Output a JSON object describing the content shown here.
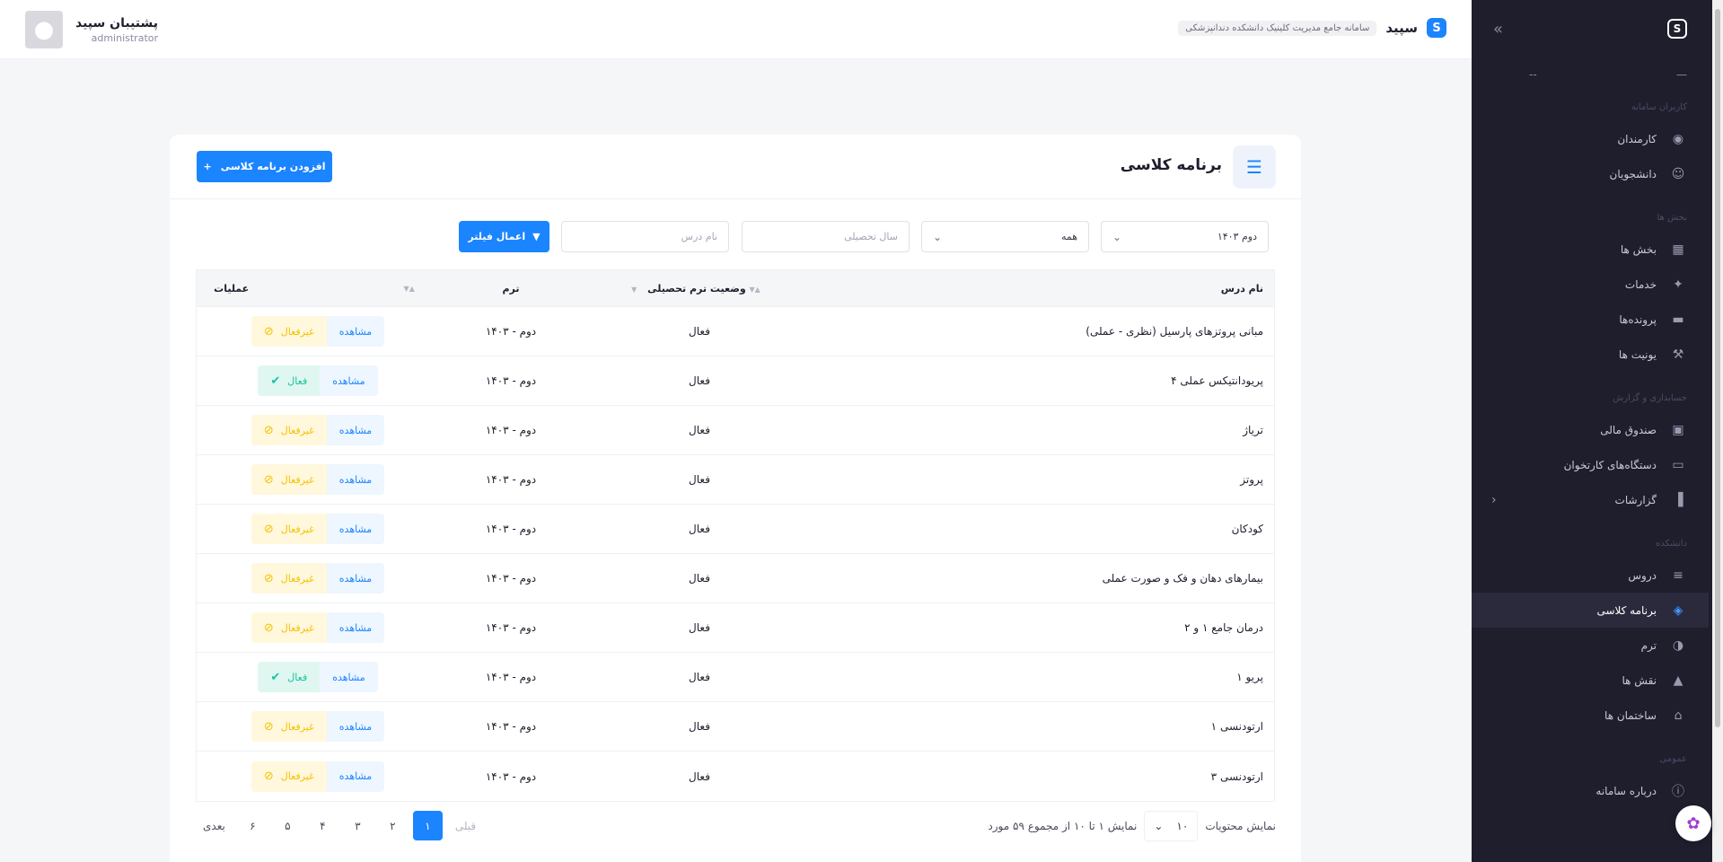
{
  "header": {
    "brand_name": "سپید",
    "brand_tag": "سامانه جامع مدیریت کلینیک دانشکده دندانپزشکی",
    "user_name": "پشتیبان سپید",
    "user_role": "administrator"
  },
  "sidebar": {
    "dash_label": "--",
    "sections": [
      {
        "title": "کاربران سامانه",
        "items": [
          {
            "label": "کارمندان",
            "icon": "user-circle-icon"
          },
          {
            "label": "دانشجویان",
            "icon": "students-icon"
          }
        ]
      },
      {
        "title": "بخش ها",
        "items": [
          {
            "label": "بخش ها",
            "icon": "grid-icon"
          },
          {
            "label": "خدمات",
            "icon": "services-icon"
          },
          {
            "label": "پرونده‌ها",
            "icon": "folder-icon"
          },
          {
            "label": "یونیت ها",
            "icon": "unit-icon"
          }
        ]
      },
      {
        "title": "حسابداری و گزارش",
        "items": [
          {
            "label": "صندوق مالی",
            "icon": "cash-icon"
          },
          {
            "label": "دستگاه‌های کارتخوان",
            "icon": "card-reader-icon"
          },
          {
            "label": "گزارشات",
            "icon": "chart-icon"
          }
        ]
      },
      {
        "title": "دانشکده",
        "items": [
          {
            "label": "دروس",
            "icon": "book-icon"
          },
          {
            "label": "برنامه کلاسی",
            "icon": "layers-icon"
          },
          {
            "label": "ترم",
            "icon": "toggle-icon"
          },
          {
            "label": "نقش ها",
            "icon": "shapes-icon"
          },
          {
            "label": "ساختمان ها",
            "icon": "building-icon"
          }
        ]
      },
      {
        "title": "عمومی",
        "items": [
          {
            "label": "درباره سامانه",
            "icon": "info-icon"
          }
        ]
      }
    ]
  },
  "page": {
    "title": "برنامه کلاسی",
    "add_button": "افزودن برنامه کلاسی"
  },
  "filters": {
    "term_value": "دوم ۱۴۰۳",
    "status_value": "همه",
    "year_placeholder": "سال تحصیلی",
    "course_placeholder": "نام درس",
    "apply_label": "اعمال فیلتر"
  },
  "table": {
    "headers": {
      "name": "نام درس",
      "status": "وضعیت ترم تحصیلی",
      "term": "ترم",
      "ops": "عملیات"
    },
    "view_label": "مشاهده",
    "rows": [
      {
        "name": "مبانی پروتزهای پارسیل (نظری - عملی)",
        "status": "فعال",
        "term": "دوم - ۱۴۰۳",
        "state": "غیرفعال",
        "state_kind": "inactive"
      },
      {
        "name": "پریودانتیکس عملی ۴",
        "status": "فعال",
        "term": "دوم - ۱۴۰۳",
        "state": "فعال",
        "state_kind": "active"
      },
      {
        "name": "تریاژ",
        "status": "فعال",
        "term": "دوم - ۱۴۰۳",
        "state": "غیرفعال",
        "state_kind": "inactive"
      },
      {
        "name": "پروتز",
        "status": "فعال",
        "term": "دوم - ۱۴۰۳",
        "state": "غیرفعال",
        "state_kind": "inactive"
      },
      {
        "name": "کودکان",
        "status": "فعال",
        "term": "دوم - ۱۴۰۳",
        "state": "غیرفعال",
        "state_kind": "inactive"
      },
      {
        "name": "بیمارهای دهان و فک و صورت عملی",
        "status": "فعال",
        "term": "دوم - ۱۴۰۳",
        "state": "غیرفعال",
        "state_kind": "inactive"
      },
      {
        "name": "درمان جامع ۱ و ۲",
        "status": "فعال",
        "term": "دوم - ۱۴۰۳",
        "state": "غیرفعال",
        "state_kind": "inactive"
      },
      {
        "name": "پریو ۱",
        "status": "فعال",
        "term": "دوم - ۱۴۰۳",
        "state": "فعال",
        "state_kind": "active"
      },
      {
        "name": "ارتودنسی ۱",
        "status": "فعال",
        "term": "دوم - ۱۴۰۳",
        "state": "غیرفعال",
        "state_kind": "inactive"
      },
      {
        "name": "ارتودنسی ۳",
        "status": "فعال",
        "term": "دوم - ۱۴۰۳",
        "state": "غیرفعال",
        "state_kind": "inactive"
      }
    ]
  },
  "footer": {
    "show_label": "نمایش محتویات",
    "page_size": "۱۰",
    "summary": "نمایش ۱ تا ۱۰ از مجموع ۵۹ مورد",
    "prev": "قبلی",
    "next": "بعدی",
    "pages": [
      "۱",
      "۲",
      "۳",
      "۴",
      "۵",
      "۶"
    ],
    "current_page": "۱"
  },
  "colors": {
    "primary": "#1b84ff",
    "sidebar": "#1e1e2d",
    "inactive": "#f6c000",
    "active": "#17c3a0"
  }
}
